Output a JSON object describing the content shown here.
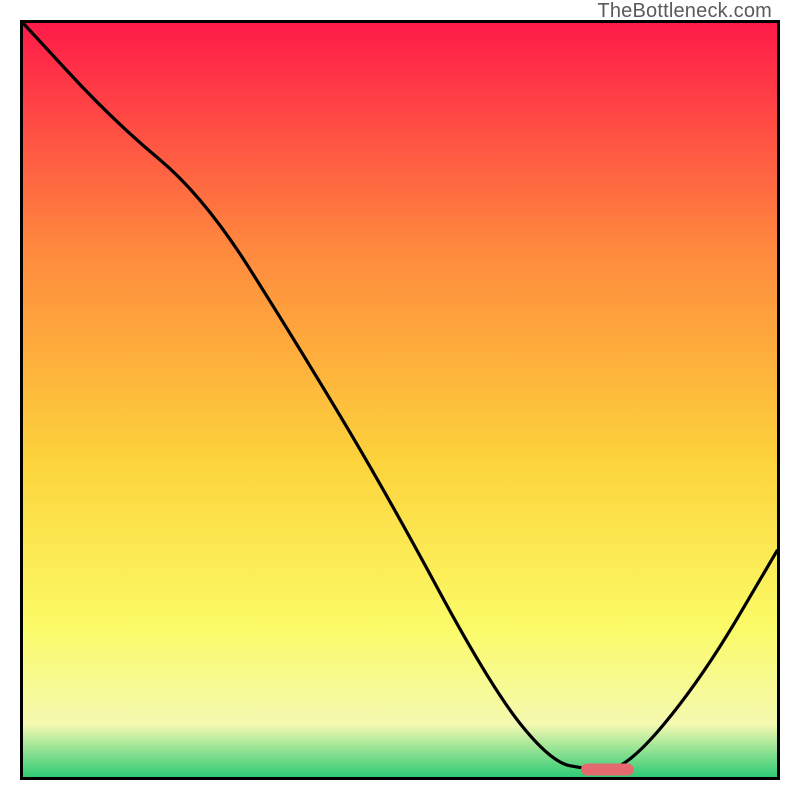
{
  "watermark": "TheBottleneck.com",
  "chart_data": {
    "type": "line",
    "title": "",
    "xlabel": "",
    "ylabel": "",
    "xlim": [
      0,
      100
    ],
    "ylim": [
      0,
      100
    ],
    "grid": false,
    "legend": false,
    "series": [
      {
        "name": "bottleneck-curve",
        "x": [
          0,
          12,
          24,
          36,
          48,
          62,
          70,
          75,
          80,
          90,
          100
        ],
        "values": [
          100,
          87,
          77,
          58,
          38,
          12,
          2,
          1,
          1,
          13,
          30
        ]
      }
    ],
    "marker": {
      "name": "optimal-range",
      "x_start": 74,
      "x_end": 81,
      "y": 1,
      "color": "#e46a6f"
    },
    "background_gradient": {
      "top": "#ff1a49",
      "mid_upper": "#ff893e",
      "mid": "#fcd33b",
      "mid_lower": "#fbfb67",
      "low_band": "#f4f9b0",
      "bottom": "#2ecb75"
    }
  }
}
